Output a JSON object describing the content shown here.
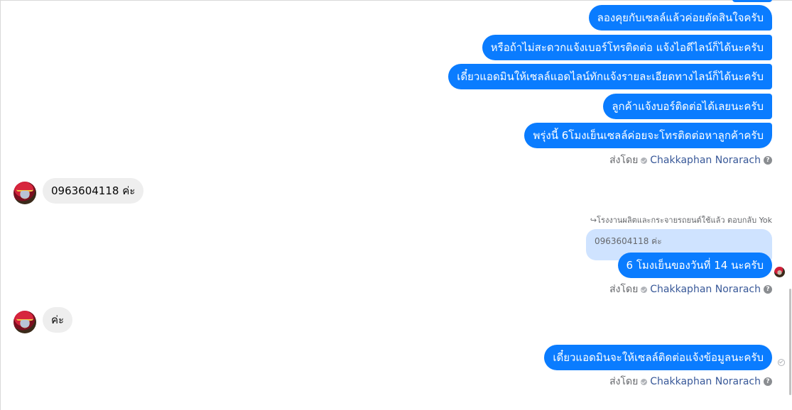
{
  "messages": {
    "out1": "ลองคุยกับเซลล์แล้วค่อยตัดสินใจครับ",
    "out2": "หรือถ้าไม่สะดวกแจ้งเบอร์โทรติดต่อ แจ้งไอดีไลน์ก็ได้นะครับ",
    "out3": "เดี๋ยวแอดมินให้เซลล์แอดไลน์ทักแจ้งรายละเอียดทางไลน์ก็ได้นะครับ",
    "out4": "ลูกค้าแจ้งบอร์ติดต่อได้เลยนะครับ",
    "out5": "พรุ่งนี้ 6โมงเย็นเซลล์ค่อยจะโทรติดต่อหาลูกค้าครับ",
    "in1": "0963604118 ค่ะ",
    "reply_meta": "โรงงานผลิตและกระจายรถยนต์ใช้แล้ว ตอบกลับ Yok",
    "quoted": "0963604118 ค่ะ",
    "out6": "6 โมงเย็นของวันที่ 14 นะครับ",
    "in2": "ค่ะ",
    "out7": "เดี๋ยวแอดมินจะให้เซลล์ติดต่อแจ้งข้อมูลนะครับ"
  },
  "sent_by": {
    "label": "ส่งโดย",
    "name": "Chakkaphan Norarach",
    "help": "?"
  }
}
